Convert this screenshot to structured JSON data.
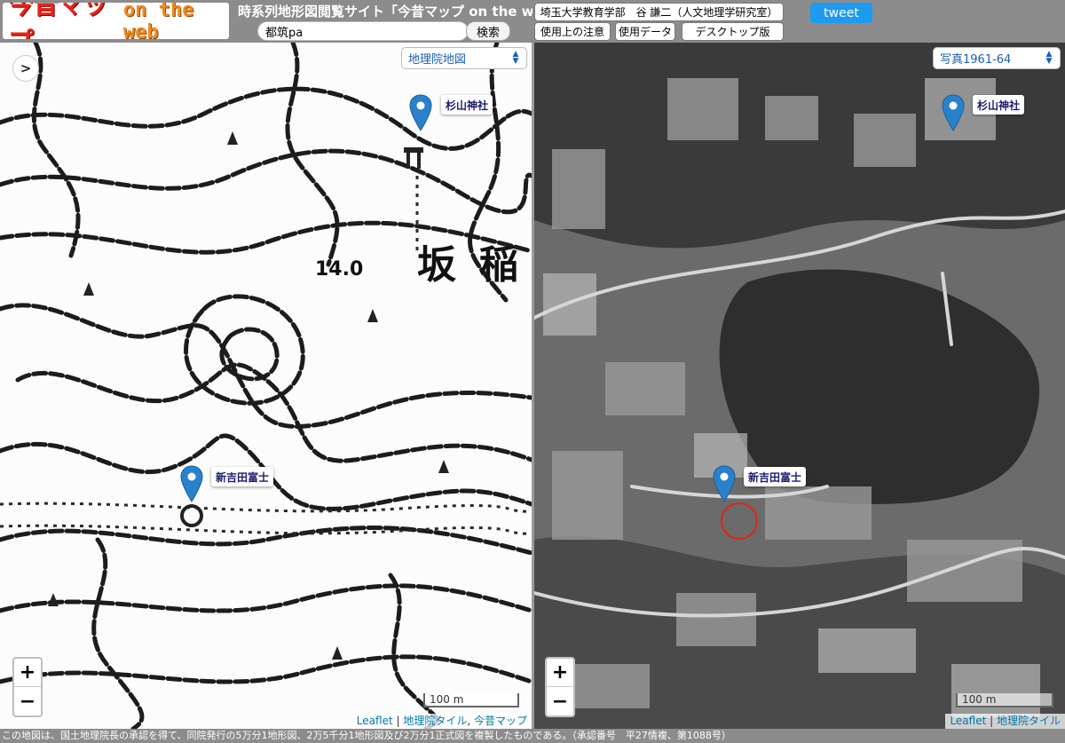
{
  "header": {
    "logo_main": "今昔マップ",
    "logo_sub": "on the web",
    "site_title": "時系列地形図閲覧サイト「今昔マップ on the web」",
    "search": {
      "value": "都筑pa",
      "placeholder": ""
    },
    "search_button": "検索",
    "author_button": "埼玉大学教育学部　谷 謙二（人文地理学研究室）",
    "notice_button": "使用上の注意",
    "data_button": "使用データ",
    "desktop_button": "デスクトップ版",
    "tweet_button": "tweet"
  },
  "left_map": {
    "layer_select": "地理院地図",
    "toggle_icon": ">",
    "markers": [
      {
        "label": "杉山神社"
      },
      {
        "label": "新吉田富士"
      }
    ],
    "scale_label": "100 m",
    "attribution": [
      "Leaflet",
      "地理院タイル",
      "今昔マップ"
    ],
    "map_text": [
      "14.0",
      "坂",
      "稲"
    ]
  },
  "right_map": {
    "layer_select": "写真1961-64",
    "markers": [
      {
        "label": "杉山神社"
      },
      {
        "label": "新吉田富士"
      }
    ],
    "scale_label": "100 m",
    "attribution": [
      "Leaflet",
      "地理院タイル"
    ]
  },
  "zoom": {
    "in": "+",
    "out": "−"
  },
  "footer": {
    "text": "この地図は、国土地理院長の承認を得て、同院発行の5万分1地形図、2万5千分1地形図及び2万分1正式図を複製したものである。（承認番号　平27情複、第1088号）"
  },
  "colors": {
    "marker_blue": "#2a81cb",
    "tweet_blue": "#1d9bf0",
    "link_blue": "#0078a8",
    "header_gray": "#8c8c8c",
    "logo_red": "#e8231c",
    "circle_red": "#e2231a"
  }
}
